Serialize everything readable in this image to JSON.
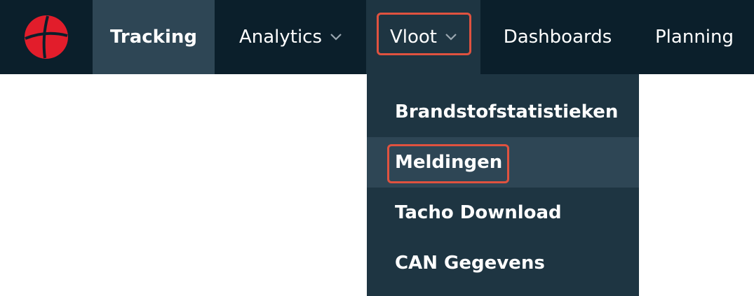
{
  "nav": {
    "logo_icon": "globe-logo-icon",
    "brand_color": "#e21d2b",
    "items": [
      {
        "label": "Tracking",
        "active": true,
        "has_dropdown": false
      },
      {
        "label": "Analytics",
        "active": false,
        "has_dropdown": true
      },
      {
        "label": "Vloot",
        "active": false,
        "has_dropdown": true,
        "open": true,
        "highlighted": true
      },
      {
        "label": "Dashboards",
        "active": false,
        "has_dropdown": false
      },
      {
        "label": "Planning",
        "active": false,
        "has_dropdown": false
      }
    ]
  },
  "dropdown": {
    "items": [
      {
        "label": "Brandstofstatistieken",
        "highlighted": false
      },
      {
        "label": "Meldingen",
        "highlighted": true,
        "hover": true
      },
      {
        "label": "Tacho Download",
        "highlighted": false
      },
      {
        "label": "CAN Gegevens",
        "highlighted": false
      }
    ]
  },
  "colors": {
    "navbar_bg": "#0b1f2b",
    "active_bg": "#2e4655",
    "dropdown_bg": "#1e3542",
    "highlight": "#e0523f"
  }
}
